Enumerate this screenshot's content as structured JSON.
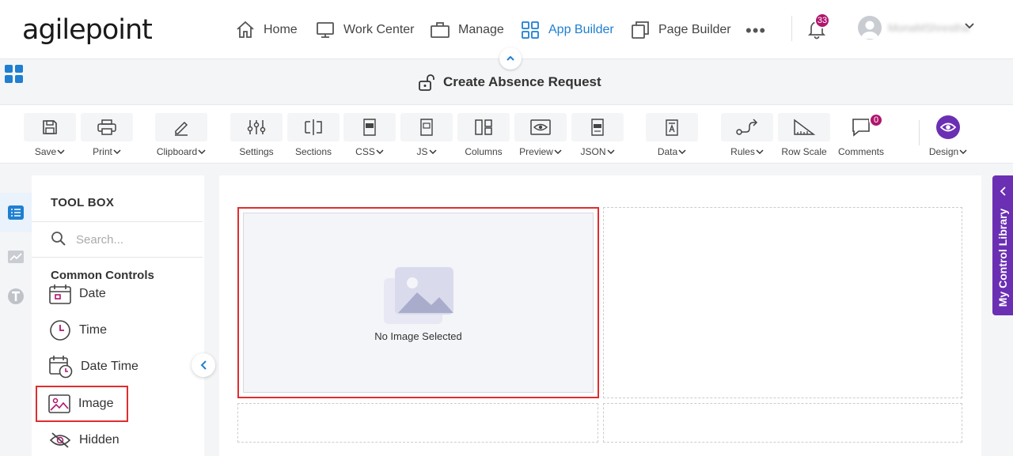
{
  "brand": {
    "logo_text": "agilepoint"
  },
  "nav": {
    "items": [
      {
        "label": "Home"
      },
      {
        "label": "Work Center"
      },
      {
        "label": "Manage"
      },
      {
        "label": "App Builder"
      },
      {
        "label": "Page Builder"
      }
    ],
    "more": "•••",
    "notification_count": "33",
    "user_name": "MonaMShrestha"
  },
  "header": {
    "title": "Create Absence Request"
  },
  "toolbar": {
    "buttons": [
      {
        "label": "Save"
      },
      {
        "label": "Print"
      },
      {
        "label": "Clipboard"
      },
      {
        "label": "Settings"
      },
      {
        "label": "Sections"
      },
      {
        "label": "CSS"
      },
      {
        "label": "JS"
      },
      {
        "label": "Columns"
      },
      {
        "label": "Preview"
      },
      {
        "label": "JSON"
      },
      {
        "label": "Data"
      },
      {
        "label": "Rules"
      },
      {
        "label": "Row Scale"
      },
      {
        "label": "Comments"
      },
      {
        "label": "Design"
      }
    ],
    "comments_count": "0"
  },
  "toolbox": {
    "title": "TOOL BOX",
    "search_placeholder": "Search...",
    "section": "Common Controls",
    "controls": [
      {
        "label": "Date"
      },
      {
        "label": "Time"
      },
      {
        "label": "Date Time"
      },
      {
        "label": "Image"
      },
      {
        "label": "Hidden"
      }
    ]
  },
  "canvas": {
    "image_placeholder": "No Image Selected"
  },
  "library": {
    "label": "My Control Library"
  },
  "colors": {
    "accent": "#1f7fd1",
    "purple": "#6b2fb3",
    "badge": "#b0166d",
    "highlight": "#e02d2d"
  }
}
